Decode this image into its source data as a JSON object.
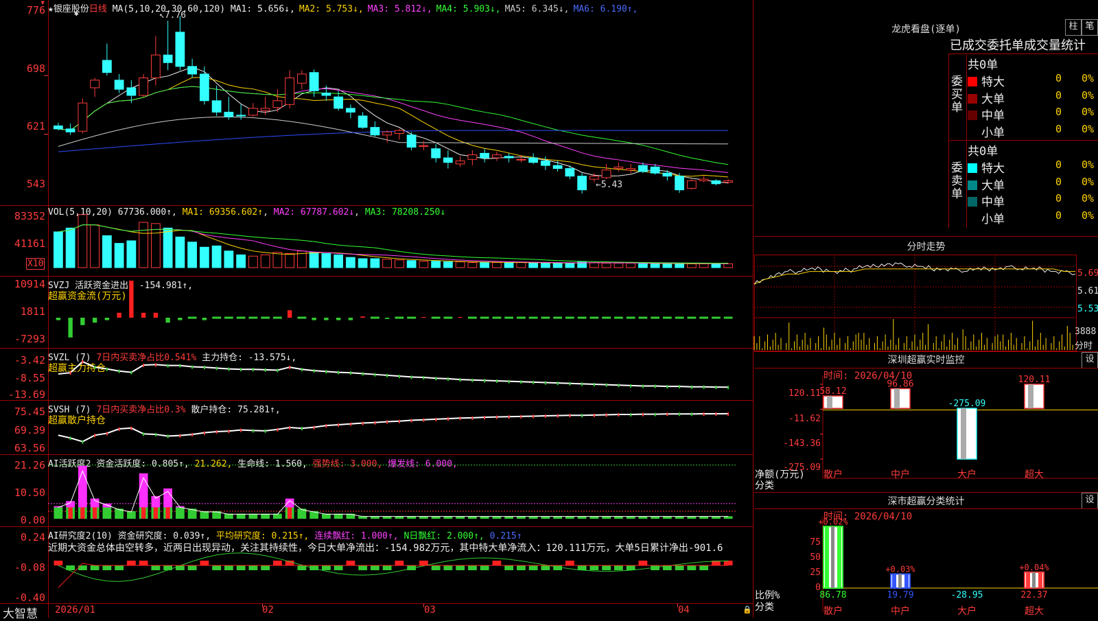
{
  "stock": {
    "star": "★",
    "name": "银座股份",
    "period": "日线"
  },
  "ma_header": {
    "label": "MA(5,10,20,30,60,120)",
    "items": [
      {
        "name": "MA1",
        "value": "5.656↓",
        "color": "#eeeeee"
      },
      {
        "name": "MA2",
        "value": "5.753↓",
        "color": "#ffd400"
      },
      {
        "name": "MA3",
        "value": "5.812↓",
        "color": "#ff40ff"
      },
      {
        "name": "MA4",
        "value": "5.903↓",
        "color": "#33ff33"
      },
      {
        "name": "MA5",
        "value": "6.345↓",
        "color": "#cccccc"
      },
      {
        "name": "MA6",
        "value": "6.190↑",
        "color": "#4a6bff"
      }
    ],
    "high_label": "7.76",
    "low_label": "5.43"
  },
  "price_axis": [
    "776",
    "698",
    "621",
    "543"
  ],
  "vol": {
    "header": "VOL(5,10,20)",
    "value": "67736.000↑",
    "ma1": "MA1: 69356.602↑",
    "ma2": "MA2: 67787.602↓",
    "ma3": "MA3: 78208.250↓",
    "axis": [
      "83352",
      "41161"
    ],
    "unit": "X10"
  },
  "svzj": {
    "header": "SVZJ  活跃资金进出: -154.981↑,",
    "sub": "超赢资金流(万元)",
    "axis": [
      "10914",
      "1811",
      "-7293"
    ]
  },
  "svzl": {
    "header": "SVZL (7)",
    "pct": "7日内买卖净占比0.541%",
    "pos": "主力持仓: -13.575↓,",
    "sub": "超赢主力持仓",
    "axis": [
      "-3.42",
      "-8.55",
      "-13.69"
    ]
  },
  "svsh": {
    "header": "SVSH (7)",
    "pct": "7日内买卖净占比0.3%",
    "pos": "散户持仓: 75.281↑,",
    "sub": "超赢散户持仓",
    "axis": [
      "75.45",
      "69.39",
      "63.56"
    ]
  },
  "ai_act": {
    "header": "AI活跃度2",
    "a": "资金活跃度: 0.805↑,",
    "b": "21.262,",
    "c": "生命线: 1.560,",
    "d": "强势线: 3.000,",
    "e": "爆发线: 6.000,",
    "axis": [
      "21.26",
      "10.50",
      "0.00"
    ]
  },
  "ai_res": {
    "header": "AI研究度2(10)",
    "a": "资金研究度: 0.039↑,",
    "b": "平均研究度: 0.215↑,",
    "c": "连续飘红: 1.000↑,",
    "d": "N日飘红: 2.000↑,",
    "e": "0.215↑",
    "text": "近期大资金总体由空转多，近两日出现异动，关注其持续性，今日大单净流出：-154.982万元，其中特大单净流入：120.111万元，大单5日累计净出-901.6",
    "axis": [
      "0.24",
      "-0.08",
      "-0.40"
    ]
  },
  "date_axis": [
    "2026/01",
    "02",
    "03",
    "04"
  ],
  "brand": "大智慧",
  "longhu": {
    "title": "龙虎看盘(逐单)",
    "btn1": "柱",
    "btn2": "笔",
    "tabs": "已成交委托单成交量统计",
    "buy": {
      "label": "委买单",
      "count": "共0单",
      "rows": [
        {
          "name": "特大",
          "v": "0",
          "p": "0%",
          "color": "#ff0000"
        },
        {
          "name": "大单",
          "v": "0",
          "p": "0%",
          "color": "#990000"
        },
        {
          "name": "中单",
          "v": "0",
          "p": "0%",
          "color": "#660000"
        },
        {
          "name": "小单",
          "v": "0",
          "p": "0%",
          "color": "#000000"
        }
      ]
    },
    "sell": {
      "label": "委卖单",
      "count": "共0单",
      "rows": [
        {
          "name": "特大",
          "v": "0",
          "p": "0%",
          "color": "#00ffff"
        },
        {
          "name": "大单",
          "v": "0",
          "p": "0%",
          "color": "#008888"
        },
        {
          "name": "中单",
          "v": "0",
          "p": "0%",
          "color": "#006666"
        },
        {
          "name": "小单",
          "v": "0",
          "p": "0%",
          "color": "#000000"
        }
      ]
    }
  },
  "intraday": {
    "title": "分时走势",
    "axis": [
      "5.69",
      "5.61",
      "5.53"
    ],
    "vol": "3888",
    "vol_unit": "分时"
  },
  "sz_monitor": {
    "title": "深圳超赢实时监控",
    "btn": "设",
    "time": "时间: 2026/04/10",
    "axis": [
      "120.11",
      "-11.62",
      "-143.36",
      "-275.09"
    ],
    "ylabel": "净额(万元)",
    "xlabel": "分类",
    "bars": [
      {
        "cat": "散户",
        "v": "58.12",
        "val": 58.12
      },
      {
        "cat": "中户",
        "v": "96.86",
        "val": 96.86
      },
      {
        "cat": "大户",
        "v": "-275.09",
        "val": -275.09
      },
      {
        "cat": "超大",
        "v": "120.11",
        "val": 120.11
      }
    ]
  },
  "sz_class": {
    "title": "深市超赢分类统计",
    "btn": "设",
    "time": "时间: 2026/04/10",
    "axis": [
      "75",
      "50",
      "25",
      "0"
    ],
    "ylabel": "比例%",
    "xlabel": "分类",
    "bars": [
      {
        "cat": "散户",
        "top": "+0.02%",
        "bottom": "86.78",
        "val": 86.78,
        "color": "#33ff33"
      },
      {
        "cat": "中户",
        "top": "+0.03%",
        "bottom": "19.79",
        "val": 19.79,
        "color": "#3355ff"
      },
      {
        "cat": "大户",
        "top": "",
        "bottom": "-28.95",
        "val": 0,
        "color": "#33ffff"
      },
      {
        "cat": "超大",
        "top": "+0.04%",
        "bottom": "22.37",
        "val": 22.37,
        "color": "#ff3b3b"
      }
    ]
  },
  "candles": [
    [
      6.32,
      6.36,
      6.26,
      6.28
    ],
    [
      6.28,
      6.35,
      6.2,
      6.24
    ],
    [
      6.25,
      6.68,
      6.22,
      6.62
    ],
    [
      6.82,
      6.95,
      6.7,
      6.92
    ],
    [
      7.18,
      7.4,
      6.98,
      7.02
    ],
    [
      6.92,
      7.0,
      6.75,
      6.8
    ],
    [
      6.82,
      6.92,
      6.62,
      6.72
    ],
    [
      6.72,
      7.0,
      6.7,
      6.95
    ],
    [
      6.95,
      7.5,
      6.85,
      7.25
    ],
    [
      7.25,
      7.7,
      7.05,
      7.15
    ],
    [
      7.55,
      7.76,
      7.05,
      7.1
    ],
    [
      7.1,
      7.2,
      6.95,
      7.0
    ],
    [
      7.0,
      7.1,
      6.6,
      6.65
    ],
    [
      6.65,
      6.85,
      6.45,
      6.5
    ],
    [
      6.5,
      6.7,
      6.4,
      6.44
    ],
    [
      6.46,
      6.6,
      6.4,
      6.45
    ],
    [
      6.46,
      6.62,
      6.44,
      6.55
    ],
    [
      6.52,
      6.7,
      6.46,
      6.55
    ],
    [
      6.56,
      6.8,
      6.5,
      6.65
    ],
    [
      6.6,
      7.05,
      6.55,
      6.95
    ],
    [
      6.88,
      7.05,
      6.8,
      7.0
    ],
    [
      7.02,
      7.06,
      6.7,
      6.78
    ],
    [
      6.75,
      6.85,
      6.65,
      6.72
    ],
    [
      6.7,
      6.78,
      6.52,
      6.55
    ],
    [
      6.55,
      6.6,
      6.42,
      6.5
    ],
    [
      6.45,
      6.5,
      6.28,
      6.3
    ],
    [
      6.3,
      6.38,
      6.18,
      6.2
    ],
    [
      6.2,
      6.26,
      6.1,
      6.24
    ],
    [
      6.22,
      6.28,
      6.14,
      6.26
    ],
    [
      6.2,
      6.24,
      6.0,
      6.04
    ],
    [
      6.05,
      6.12,
      6.0,
      6.06
    ],
    [
      6.02,
      6.08,
      5.84,
      5.9
    ],
    [
      5.9,
      6.0,
      5.76,
      5.84
    ],
    [
      5.82,
      5.92,
      5.78,
      5.86
    ],
    [
      5.88,
      6.0,
      5.8,
      5.94
    ],
    [
      5.96,
      6.02,
      5.84,
      5.9
    ],
    [
      5.9,
      5.98,
      5.86,
      5.94
    ],
    [
      5.92,
      5.96,
      5.84,
      5.9
    ],
    [
      5.88,
      5.94,
      5.84,
      5.88
    ],
    [
      5.9,
      5.96,
      5.82,
      5.84
    ],
    [
      5.86,
      5.92,
      5.74,
      5.8
    ],
    [
      5.8,
      5.86,
      5.72,
      5.76
    ],
    [
      5.76,
      5.8,
      5.62,
      5.66
    ],
    [
      5.66,
      5.7,
      5.43,
      5.48
    ],
    [
      5.62,
      5.7,
      5.58,
      5.66
    ],
    [
      5.64,
      5.82,
      5.62,
      5.74
    ],
    [
      5.76,
      5.84,
      5.72,
      5.78
    ],
    [
      5.74,
      5.82,
      5.7,
      5.76
    ],
    [
      5.8,
      5.84,
      5.7,
      5.72
    ],
    [
      5.78,
      5.82,
      5.68,
      5.7
    ],
    [
      5.7,
      5.74,
      5.6,
      5.66
    ],
    [
      5.66,
      5.7,
      5.44,
      5.48
    ],
    [
      5.5,
      5.62,
      5.48,
      5.6
    ],
    [
      5.6,
      5.66,
      5.58,
      5.62
    ],
    [
      5.6,
      5.62,
      5.54,
      5.56
    ],
    [
      5.58,
      5.62,
      5.56,
      5.6
    ]
  ],
  "volumes": [
    56,
    62,
    83,
    67,
    50,
    38,
    42,
    71,
    69,
    62,
    48,
    40,
    32,
    34,
    26,
    20,
    18,
    20,
    24,
    22,
    26,
    24,
    22,
    20,
    16,
    14,
    14,
    13,
    12,
    11,
    10,
    10,
    9,
    9,
    8,
    8,
    8,
    8,
    8,
    7,
    7,
    7,
    7,
    9,
    8,
    7,
    7,
    7,
    6,
    6,
    6,
    7,
    6,
    6,
    6,
    6
  ],
  "svzj_vals": [
    -1,
    -8,
    -3,
    -2,
    -1,
    2,
    15,
    2,
    2,
    -2,
    -1,
    0,
    -1,
    0,
    0,
    0,
    0,
    0,
    0,
    3,
    0,
    -1,
    -1,
    -1,
    -1,
    0.5,
    0,
    -0.5,
    0,
    0,
    0.3,
    0,
    0,
    0.3,
    0,
    0,
    0,
    0,
    0,
    0,
    0,
    0,
    0,
    0,
    0,
    0,
    0,
    0,
    0,
    0,
    0,
    0,
    0,
    0,
    0,
    0
  ],
  "svzl_line": [
    -10.5,
    -10.2,
    -7.6,
    -8.9,
    -9.3,
    -9.8,
    -10.1,
    -8.4,
    -8.3,
    -8.5,
    -8.5,
    -8.8,
    -8.9,
    -9.1,
    -9.3,
    -9.4,
    -9.4,
    -9.5,
    -9.6,
    -8.9,
    -9.4,
    -9.7,
    -9.9,
    -10.1,
    -10.2,
    -10.4,
    -10.6,
    -10.8,
    -11.0,
    -11.2,
    -11.3,
    -11.5,
    -11.6,
    -11.8,
    -11.9,
    -12.0,
    -12.1,
    -12.2,
    -12.3,
    -12.4,
    -12.5,
    -12.6,
    -12.7,
    -12.8,
    -12.9,
    -13.0,
    -13.1,
    -13.2,
    -13.3,
    -13.3,
    -13.4,
    -13.4,
    -13.5,
    -13.5,
    -13.55,
    -13.575
  ],
  "svsh_line": [
    67.5,
    66.5,
    65.2,
    67.5,
    68.2,
    69.8,
    70.1,
    68.0,
    67.8,
    67.2,
    67.4,
    67.8,
    68.4,
    68.8,
    69.0,
    69.4,
    69.2,
    69.1,
    69.6,
    70.3,
    70.0,
    70.4,
    71.0,
    71.3,
    71.6,
    71.9,
    72.1,
    72.4,
    72.6,
    72.9,
    73.1,
    73.3,
    73.5,
    73.7,
    73.8,
    74.0,
    74.1,
    74.2,
    74.3,
    74.4,
    74.5,
    74.6,
    74.7,
    74.7,
    74.8,
    74.9,
    75.0,
    75.0,
    75.1,
    75.1,
    75.2,
    75.2,
    75.2,
    75.25,
    75.27,
    75.281
  ],
  "ai_act_vals": [
    5,
    7,
    21,
    8,
    6,
    4,
    3,
    18,
    9,
    12,
    5,
    4,
    3,
    3,
    2,
    2,
    2,
    2,
    2,
    8,
    4,
    3,
    2,
    2,
    2,
    1,
    1,
    1,
    1,
    1,
    1,
    1,
    1,
    1,
    1,
    1,
    1,
    1,
    1,
    1,
    1,
    1,
    1,
    1,
    1,
    1,
    1,
    1,
    1,
    1,
    1,
    1,
    1,
    1,
    1,
    1
  ],
  "ai_res_vals": [
    -0.08,
    -0.05,
    -0.12,
    -0.2,
    -0.18,
    -0.1,
    -0.05,
    0.02,
    -0.12,
    -0.2,
    -0.22,
    -0.18,
    -0.16,
    -0.14,
    -0.12,
    -0.1,
    -0.09,
    -0.08,
    -0.08,
    0.02,
    -0.05,
    -0.1,
    -0.14,
    -0.12,
    -0.1,
    -0.08,
    -0.06,
    -0.1,
    -0.14,
    -0.16,
    -0.18,
    -0.16,
    -0.14,
    -0.12,
    -0.12,
    -0.1,
    -0.1,
    -0.1,
    -0.09,
    -0.09,
    -0.1,
    -0.12,
    -0.14,
    -0.1,
    -0.08,
    -0.06,
    -0.1,
    -0.12,
    -0.1,
    -0.08,
    -0.06,
    -0.04,
    -0.02,
    -0.04,
    0.02,
    0.039
  ],
  "intraday_line": [
    5.62,
    5.64,
    5.66,
    5.67,
    5.67,
    5.68,
    5.68,
    5.67,
    5.67,
    5.68,
    5.69,
    5.69,
    5.7,
    5.7,
    5.69,
    5.69,
    5.68,
    5.68,
    5.68,
    5.67,
    5.68,
    5.68,
    5.68,
    5.69,
    5.68,
    5.68,
    5.68,
    5.67,
    5.67,
    5.66
  ],
  "intraday_avg": [
    5.62,
    5.64,
    5.65,
    5.66,
    5.66,
    5.67,
    5.67,
    5.67,
    5.67,
    5.67,
    5.68,
    5.68,
    5.68,
    5.68,
    5.68,
    5.68,
    5.68,
    5.68,
    5.68,
    5.68,
    5.68,
    5.68,
    5.68,
    5.68,
    5.68,
    5.68,
    5.68,
    5.68,
    5.67,
    5.67
  ]
}
